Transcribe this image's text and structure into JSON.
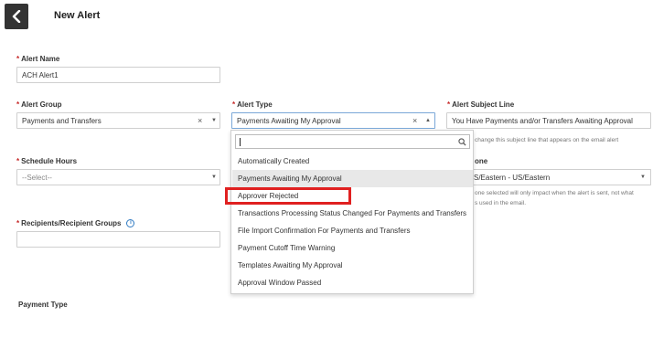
{
  "header": {
    "title": "New Alert",
    "back_icon": "chevron-left-icon"
  },
  "alert_name": {
    "label": "Alert Name",
    "value": "ACH Alert1"
  },
  "alert_group": {
    "label": "Alert Group",
    "value": "Payments and Transfers",
    "clear": "×",
    "caret": "▼"
  },
  "alert_type": {
    "label": "Alert Type",
    "value": "Payments Awaiting My Approval",
    "clear": "×",
    "caret": "▲",
    "options": [
      "Automatically Created",
      "Payments Awaiting My Approval",
      "Approver Rejected",
      "Transactions Processing Status Changed For Payments and Transfers",
      "File Import Confirmation For Payments and Transfers",
      "Payment Cutoff Time Warning",
      "Templates Awaiting My Approval",
      "Approval Window Passed"
    ],
    "selected_option": "Payments Awaiting My Approval",
    "highlighted_option": "Approver Rejected",
    "highlight_color": "#e02020"
  },
  "alert_subject": {
    "label": "Alert Subject Line",
    "value": "You Have Payments and/or Transfers Awaiting Approval",
    "hint": "change this subject line that appears on the email alert"
  },
  "schedule_hours": {
    "label": "Schedule Hours",
    "value": "--Select--",
    "caret": "▼"
  },
  "timezone": {
    "label_partial": "one",
    "value_partial": "S/Eastern - US/Eastern",
    "caret": "▼",
    "hint_line1": "one selected will only impact when the alert is sent, not what",
    "hint_line2": "s used in the email."
  },
  "recipients": {
    "label": "Recipients/Recipient Groups",
    "info_icon": "i",
    "value": ""
  },
  "payment_type": {
    "label": "Payment Type"
  },
  "required_marker": "*"
}
